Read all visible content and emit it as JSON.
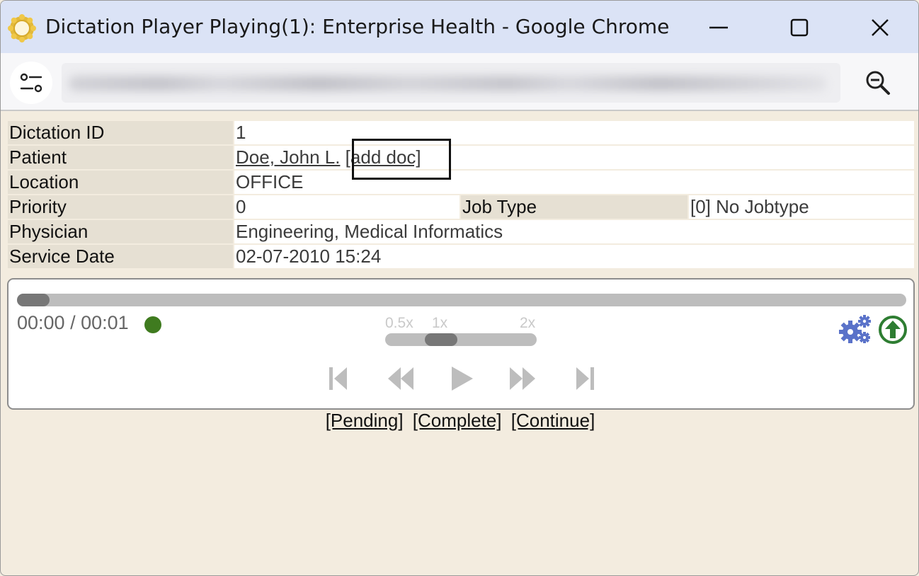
{
  "window": {
    "title": "Dictation Player Playing(1): Enterprise Health - Google Chrome"
  },
  "icons": {
    "app": "sun-logo-icon",
    "minimize": "minimize-icon",
    "maximize": "maximize-icon",
    "close": "close-icon",
    "site_settings": "site-settings-icon",
    "zoom": "zoom-out-icon",
    "gear": "gear-icon",
    "upload": "upload-icon"
  },
  "colors": {
    "titlebar": "#dbe3f6",
    "page_bg": "#f3ecdf",
    "status_dot": "#3f7b1f",
    "gear": "#5a72c9",
    "upload": "#2e7d32"
  },
  "info": {
    "dictation_id_label": "Dictation ID",
    "dictation_id_value": "1",
    "patient_label": "Patient",
    "patient_name": "Doe, John L.",
    "add_doc": "[add doc]",
    "location_label": "Location",
    "location_value": "OFFICE",
    "priority_label": "Priority",
    "priority_value": "0",
    "job_type_label": "Job Type",
    "job_type_value": "[0] No Jobtype",
    "physician_label": "Physician",
    "physician_value": "Engineering, Medical Informatics",
    "service_date_label": "Service Date",
    "service_date_value": "02-07-2010 15:24"
  },
  "player": {
    "time": "00:00 / 00:01",
    "progress_fraction": 0.02,
    "speed_labels": [
      "0.5x",
      "1x",
      "2x"
    ],
    "speed_value": "1x",
    "controls": [
      "skip-to-start",
      "rewind",
      "play",
      "fast-forward",
      "skip-to-end"
    ]
  },
  "actions": {
    "pending": "[Pending]",
    "complete": "[Complete]",
    "continue": "[Continue]"
  }
}
